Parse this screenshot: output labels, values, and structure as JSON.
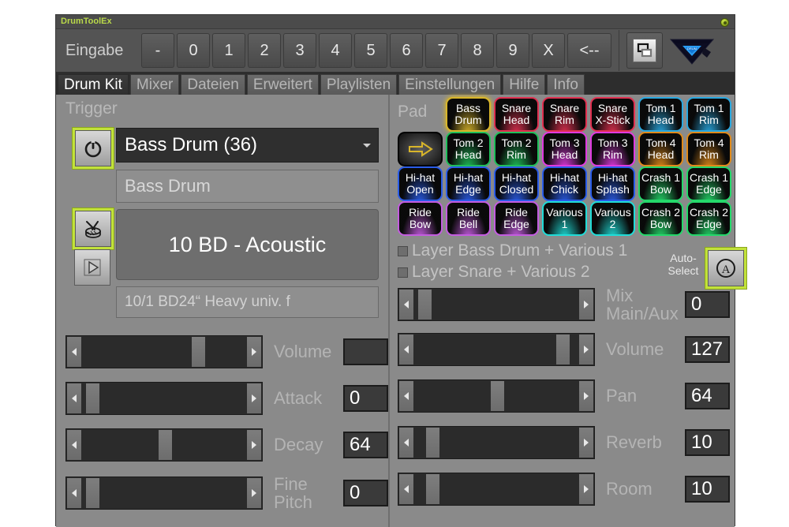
{
  "window": {
    "title": "DrumToolEx",
    "status_indicator": "status-led-green"
  },
  "toolbar": {
    "input_label": "Eingabe",
    "keys": [
      "-",
      "0",
      "1",
      "2",
      "3",
      "4",
      "5",
      "6",
      "7",
      "8",
      "9",
      "X",
      "<--"
    ],
    "window_button_icon": "windows-cascade-icon",
    "logo_icon": "drum-tool-logo-icon"
  },
  "tabs": [
    {
      "label": "Drum Kit",
      "active": true
    },
    {
      "label": "Mixer",
      "active": false
    },
    {
      "label": "Dateien",
      "active": false
    },
    {
      "label": "Erweitert",
      "active": false
    },
    {
      "label": "Playlisten",
      "active": false
    },
    {
      "label": "Einstellungen",
      "active": false
    },
    {
      "label": "Hilfe",
      "active": false
    },
    {
      "label": "Info",
      "active": false
    }
  ],
  "trigger": {
    "section_label": "Trigger",
    "power_button_icon": "power-icon",
    "drum_button_icon": "drum-icon",
    "play_button_icon": "play-icon",
    "select_value": "Bass Drum (36)",
    "name_value": "Bass Drum",
    "instrument_value": "10 BD - Acoustic",
    "instrument_detail": "10/1  BD24“ Heavy  univ.  f"
  },
  "trigger_sliders": [
    {
      "label": "Volume",
      "label2": "",
      "value": "",
      "pos": 72
    },
    {
      "label": "Attack",
      "label2": "",
      "value": "0",
      "pos": 3
    },
    {
      "label": "Decay",
      "label2": "",
      "value": "64",
      "pos": 50
    },
    {
      "label": "Fine",
      "label2": "Pitch",
      "value": "0",
      "pos": 3
    }
  ],
  "pad": {
    "section_label": "Pad",
    "shift_button_icon": "arrow-right-icon",
    "items": [
      {
        "l1": "Bass",
        "l2": "Drum",
        "color": "#d8b52a",
        "selected": true
      },
      {
        "l1": "Snare",
        "l2": "Head",
        "color": "#e03050",
        "selected": false
      },
      {
        "l1": "Snare",
        "l2": "Rim",
        "color": "#e03050",
        "selected": false
      },
      {
        "l1": "Snare",
        "l2": "X-Stick",
        "color": "#e03050",
        "selected": false
      },
      {
        "l1": "Tom 1",
        "l2": "Head",
        "color": "#29a8e0",
        "selected": false
      },
      {
        "l1": "Tom 1",
        "l2": "Rim",
        "color": "#29a8e0",
        "selected": false
      },
      {
        "l1": "Tom 2",
        "l2": "Head",
        "color": "#1fbf5a",
        "selected": false
      },
      {
        "l1": "Tom 2",
        "l2": "Rim",
        "color": "#1fbf5a",
        "selected": false
      },
      {
        "l1": "Tom 3",
        "l2": "Head",
        "color": "#e03ae0",
        "selected": false
      },
      {
        "l1": "Tom 3",
        "l2": "Rim",
        "color": "#e03ae0",
        "selected": false
      },
      {
        "l1": "Tom 4",
        "l2": "Head",
        "color": "#e08a1a",
        "selected": false
      },
      {
        "l1": "Tom 4",
        "l2": "Rim",
        "color": "#e08a1a",
        "selected": false
      },
      {
        "l1": "Hi-hat",
        "l2": "Open",
        "color": "#2a5ce8",
        "selected": false
      },
      {
        "l1": "Hi-hat",
        "l2": "Edge",
        "color": "#2a5ce8",
        "selected": false
      },
      {
        "l1": "Hi-hat",
        "l2": "Closed",
        "color": "#2a5ce8",
        "selected": false
      },
      {
        "l1": "Hi-hat",
        "l2": "Chick",
        "color": "#2a5ce8",
        "selected": false
      },
      {
        "l1": "Hi-hat",
        "l2": "Splash",
        "color": "#2a5ce8",
        "selected": false
      },
      {
        "l1": "Crash 1",
        "l2": "Bow",
        "color": "#24d86a",
        "selected": false
      },
      {
        "l1": "Crash 1",
        "l2": "Edge",
        "color": "#24d86a",
        "selected": false
      },
      {
        "l1": "Ride",
        "l2": "Bow",
        "color": "#c45ce0",
        "selected": false
      },
      {
        "l1": "Ride",
        "l2": "Bell",
        "color": "#c45ce0",
        "selected": false
      },
      {
        "l1": "Ride",
        "l2": "Edge",
        "color": "#c45ce0",
        "selected": false
      },
      {
        "l1": "Various",
        "l2": "1",
        "color": "#20ddd8",
        "selected": false
      },
      {
        "l1": "Various",
        "l2": "2",
        "color": "#20ddd8",
        "selected": false
      },
      {
        "l1": "Crash 2",
        "l2": "Bow",
        "color": "#24d86a",
        "selected": false
      },
      {
        "l1": "Crash 2",
        "l2": "Edge",
        "color": "#24d86a",
        "selected": false
      }
    ]
  },
  "layers": [
    {
      "label": "Layer Bass Drum + Various 1",
      "checked": false
    },
    {
      "label": "Layer Snare + Various 2",
      "checked": false
    }
  ],
  "auto_select": {
    "label_line1": "Auto-",
    "label_line2": "Select",
    "button_icon": "auto-select-a-icon"
  },
  "pad_sliders": [
    {
      "label": "Mix",
      "label2": "Main/Aux",
      "value": "0",
      "pos": 3
    },
    {
      "label": "Volume",
      "label2": "",
      "value": "127",
      "pos": 93
    },
    {
      "label": "Pan",
      "label2": "",
      "value": "64",
      "pos": 50
    },
    {
      "label": "Reverb",
      "label2": "",
      "value": "10",
      "pos": 8
    },
    {
      "label": "Room",
      "label2": "",
      "value": "10",
      "pos": 8
    }
  ]
}
